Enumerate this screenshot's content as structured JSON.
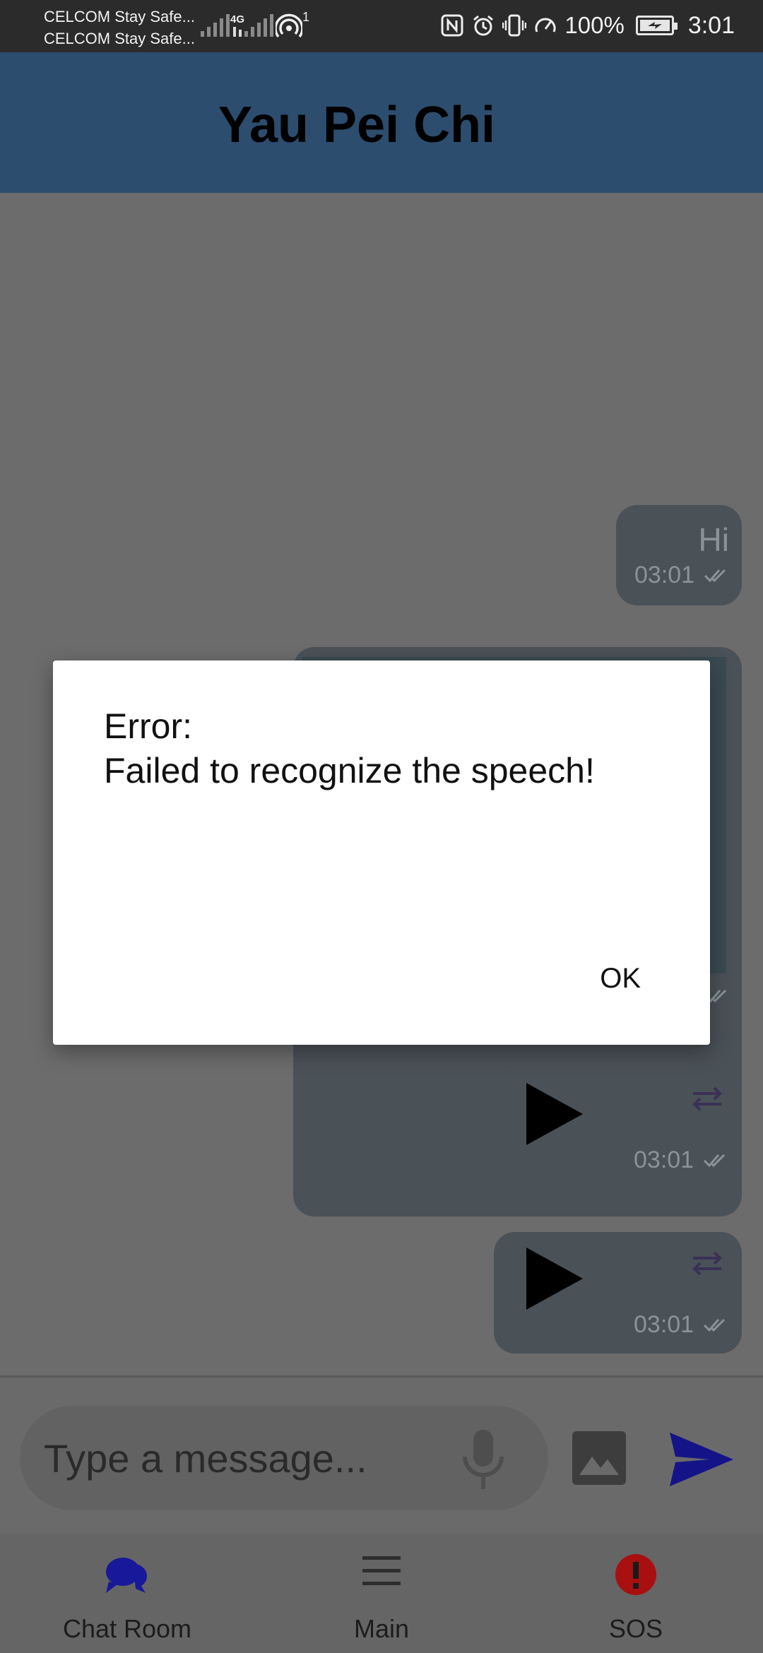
{
  "status_bar": {
    "carrier_1": "CELCOM Stay Safe...",
    "carrier_2": "CELCOM Stay Safe...",
    "network_type": "4G",
    "hotspot_count": "1",
    "battery_percent": "100%",
    "time": "3:01"
  },
  "header": {
    "title": "Yau Pei Chi"
  },
  "messages": [
    {
      "type": "text",
      "text": "Hi",
      "time": "03:01"
    },
    {
      "type": "image"
    },
    {
      "type": "audio",
      "time": "03:01"
    },
    {
      "type": "audio",
      "time": "03:01"
    }
  ],
  "composer": {
    "placeholder": "Type a message..."
  },
  "nav": {
    "items": [
      {
        "label": "Chat Room"
      },
      {
        "label": "Main"
      },
      {
        "label": "SOS"
      }
    ]
  },
  "dialog": {
    "line_1": "Error:",
    "line_2": "Failed to recognize the speech!",
    "ok_label": "OK"
  },
  "colors": {
    "header": "#2c4d6e",
    "accent_blue": "#1a1aa8",
    "sos_red": "#b31313",
    "bubble": "#4a5157"
  }
}
